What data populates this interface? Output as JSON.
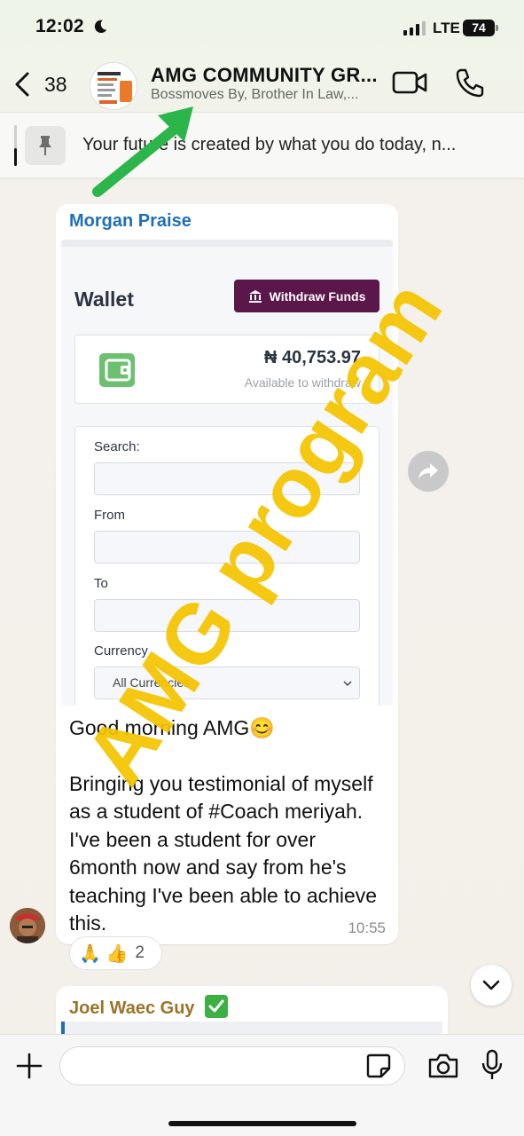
{
  "status_bar": {
    "time": "12:02",
    "network": "LTE",
    "battery": "74"
  },
  "header": {
    "back_count": "38",
    "title": "AMG COMMUNITY GR...",
    "members": "Bossmoves By, Brother In Law,..."
  },
  "pinned": {
    "text": "Your future is created by what you do today, n..."
  },
  "messages": [
    {
      "sender": "Morgan Praise",
      "screenshot": {
        "title": "Wallet",
        "withdraw_label": "Withdraw Funds",
        "balance": "₦ 40,753.97",
        "balance_sub": "Available to withdraw",
        "search_label": "Search:",
        "from_label": "From",
        "to_label": "To",
        "currency_label": "Currency",
        "currency_value": "All Currencies"
      },
      "text_line1": "Good morning AMG😊",
      "text_body": "Bringing you testimonial of myself as a student of #Coach meriyah. I've been a student for over 6month now and say from he's teaching I've been able to achieve this.",
      "time": "10:55",
      "reactions": {
        "emojis": "🙏 👍",
        "count": "2"
      }
    },
    {
      "sender": "Joel Waec Guy"
    }
  ],
  "overlay": {
    "watermark": "AMG program"
  },
  "colors": {
    "accent_link": "#1f6fb5",
    "withdraw_button": "#5b164a",
    "watermark": "#f5c400",
    "arrow": "#2bb54a"
  }
}
